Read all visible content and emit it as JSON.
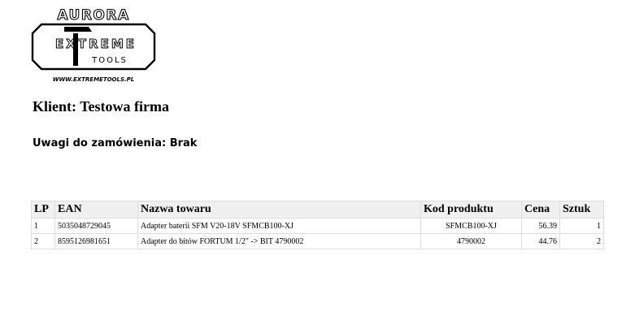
{
  "logo": {
    "top_text": "AURORA",
    "word_1": "EXTREME",
    "word_2": "TOOLS",
    "url": "WWW.EXTREMETOOLS.PL"
  },
  "client": {
    "label": "Klient:",
    "value": "Testowa firma"
  },
  "notes": {
    "label": "Uwagi do zamówienia:",
    "value": "Brak"
  },
  "table": {
    "headers": [
      "LP",
      "EAN",
      "Nazwa towaru",
      "Kod produktu",
      "Cena",
      "Sztuk"
    ],
    "rows": [
      [
        "1",
        "5035048729045",
        "Adapter baterii SFM V20-18V SFMCB100-XJ",
        "SFMCB100-XJ",
        "56.39",
        "1"
      ],
      [
        "2",
        "8595126981651",
        "Adapter do bitów FORTUM 1/2\" -> BIT 4790002",
        "4790002",
        "44.76",
        "2"
      ]
    ]
  }
}
